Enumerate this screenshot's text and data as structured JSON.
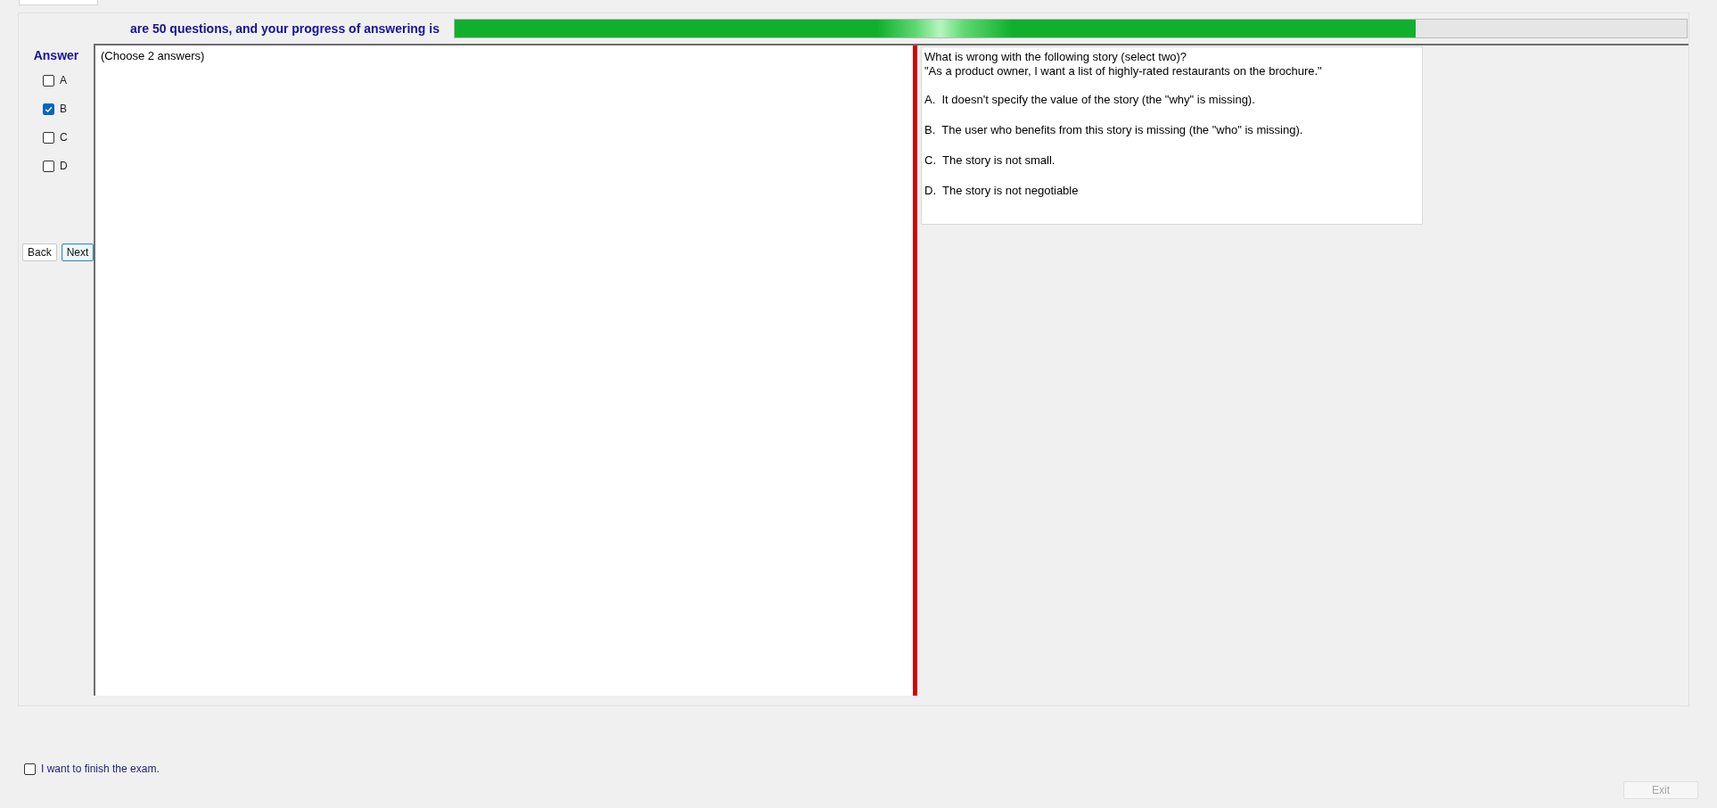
{
  "header": {
    "progress_text": "are 50 questions, and your progress of answering is",
    "progress": {
      "level": 0.78
    }
  },
  "answer_panel": {
    "title": "Answer",
    "options": [
      {
        "label": "A",
        "checked": false
      },
      {
        "label": "B",
        "checked": true
      },
      {
        "label": "C",
        "checked": false
      },
      {
        "label": "D",
        "checked": false
      }
    ],
    "buttons": [
      {
        "label": "Back",
        "focused": false
      },
      {
        "label": "Next",
        "focused": true
      }
    ]
  },
  "answer_area": {
    "instruction": "(Choose 2 answers)"
  },
  "question": {
    "prompt": "What is wrong with the following story (select two)?",
    "story": "\"As a product owner, I want a list of highly-rated restaurants on the brochure.\"",
    "options": [
      "A.  It doesn't specify the value of the story (the \"why\" is missing).",
      "B.  The user who benefits from this story is missing (the \"who\" is missing).",
      "C.  The story is not small.",
      "D.  The story is not negotiable"
    ]
  },
  "footer": {
    "finish_checkbox": {
      "label": "I want to finish the exam.",
      "checked": false
    },
    "exit_button": {
      "label": "Exit",
      "disabled": true
    }
  }
}
